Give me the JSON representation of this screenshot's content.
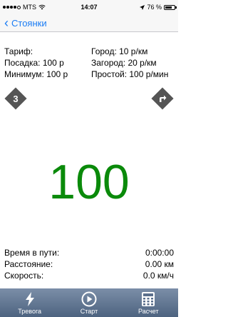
{
  "status": {
    "carrier": "MTS",
    "time": "14:07",
    "battery_text": "76 %",
    "battery_level": 0.76
  },
  "nav": {
    "back_label": "Стоянки"
  },
  "tariff": {
    "rows": [
      {
        "left": "Тариф:",
        "right": "Город: 10 р/км"
      },
      {
        "left": "Посадка: 100 р",
        "right": "Загород: 20 р/км"
      },
      {
        "left": "Минимум: 100 р",
        "right": "Простой: 100 р/мин"
      }
    ]
  },
  "buttons": {
    "left_diamond": "3",
    "right_diamond_icon": "turn-right-arrow-icon"
  },
  "fare": "100",
  "stats": [
    {
      "label": "Время в пути:",
      "value": "0:00:00"
    },
    {
      "label": "Расстояние:",
      "value": "0.00 км"
    },
    {
      "label": "Скорость:",
      "value": "0.0 км/ч"
    }
  ],
  "tabs": [
    {
      "label": "Тревога",
      "icon": "lightning-icon"
    },
    {
      "label": "Старт",
      "icon": "play-icon"
    },
    {
      "label": "Расчет",
      "icon": "calculator-icon"
    }
  ],
  "colors": {
    "fare": "#0a8a0a",
    "nav_link": "#1a7cf4",
    "tab_bar": "#5b6f8c"
  }
}
